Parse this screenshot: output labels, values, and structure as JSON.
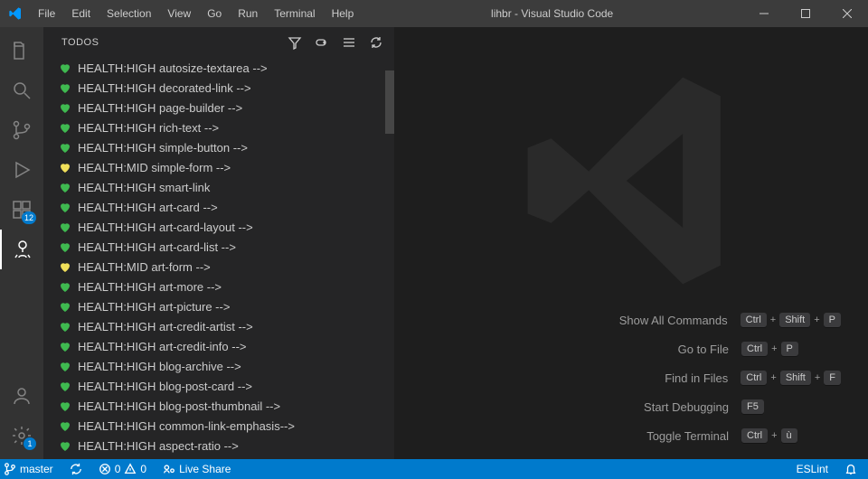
{
  "window": {
    "title": "lihbr - Visual Studio Code"
  },
  "menu": [
    "File",
    "Edit",
    "Selection",
    "View",
    "Go",
    "Run",
    "Terminal",
    "Help"
  ],
  "activitybar": {
    "items": [
      {
        "name": "explorer",
        "active": false
      },
      {
        "name": "search",
        "active": false
      },
      {
        "name": "source-control",
        "active": false
      },
      {
        "name": "run-debug",
        "active": false
      },
      {
        "name": "extensions",
        "active": false,
        "badge": "12"
      },
      {
        "name": "todo-tree",
        "active": true
      }
    ],
    "bottom": [
      {
        "name": "accounts"
      },
      {
        "name": "settings",
        "badge": "1"
      }
    ]
  },
  "sidebar": {
    "title": "TODOS",
    "actions": [
      "filter-icon",
      "tag-icon",
      "list-icon",
      "refresh-icon"
    ],
    "items": [
      {
        "level": "HIGH",
        "text": "HEALTH:HIGH autosize-textarea -->"
      },
      {
        "level": "HIGH",
        "text": "HEALTH:HIGH decorated-link -->"
      },
      {
        "level": "HIGH",
        "text": "HEALTH:HIGH page-builder -->"
      },
      {
        "level": "HIGH",
        "text": "HEALTH:HIGH rich-text -->"
      },
      {
        "level": "HIGH",
        "text": "HEALTH:HIGH simple-button -->"
      },
      {
        "level": "MID",
        "text": "HEALTH:MID simple-form -->"
      },
      {
        "level": "HIGH",
        "text": "HEALTH:HIGH smart-link"
      },
      {
        "level": "HIGH",
        "text": "HEALTH:HIGH art-card -->"
      },
      {
        "level": "HIGH",
        "text": "HEALTH:HIGH art-card-layout -->"
      },
      {
        "level": "HIGH",
        "text": "HEALTH:HIGH art-card-list -->"
      },
      {
        "level": "MID",
        "text": "HEALTH:MID art-form -->"
      },
      {
        "level": "HIGH",
        "text": "HEALTH:HIGH art-more -->"
      },
      {
        "level": "HIGH",
        "text": "HEALTH:HIGH art-picture -->"
      },
      {
        "level": "HIGH",
        "text": "HEALTH:HIGH art-credit-artist -->"
      },
      {
        "level": "HIGH",
        "text": "HEALTH:HIGH art-credit-info -->"
      },
      {
        "level": "HIGH",
        "text": "HEALTH:HIGH blog-archive -->"
      },
      {
        "level": "HIGH",
        "text": "HEALTH:HIGH blog-post-card -->"
      },
      {
        "level": "HIGH",
        "text": "HEALTH:HIGH blog-post-thumbnail -->"
      },
      {
        "level": "HIGH",
        "text": "HEALTH:HIGH common-link-emphasis-->"
      },
      {
        "level": "HIGH",
        "text": "HEALTH:HIGH aspect-ratio -->"
      }
    ]
  },
  "welcome": {
    "shortcuts": [
      {
        "label": "Show All Commands",
        "keys": [
          "Ctrl",
          "+",
          "Shift",
          "+",
          "P"
        ]
      },
      {
        "label": "Go to File",
        "keys": [
          "Ctrl",
          "+",
          "P"
        ]
      },
      {
        "label": "Find in Files",
        "keys": [
          "Ctrl",
          "+",
          "Shift",
          "+",
          "F"
        ]
      },
      {
        "label": "Start Debugging",
        "keys": [
          "F5"
        ]
      },
      {
        "label": "Toggle Terminal",
        "keys": [
          "Ctrl",
          "+",
          "ù"
        ]
      }
    ]
  },
  "statusbar": {
    "branch": "master",
    "sync": "",
    "errors": "0",
    "warnings": "0",
    "liveshare": "Live Share",
    "eslint": "ESLint"
  }
}
